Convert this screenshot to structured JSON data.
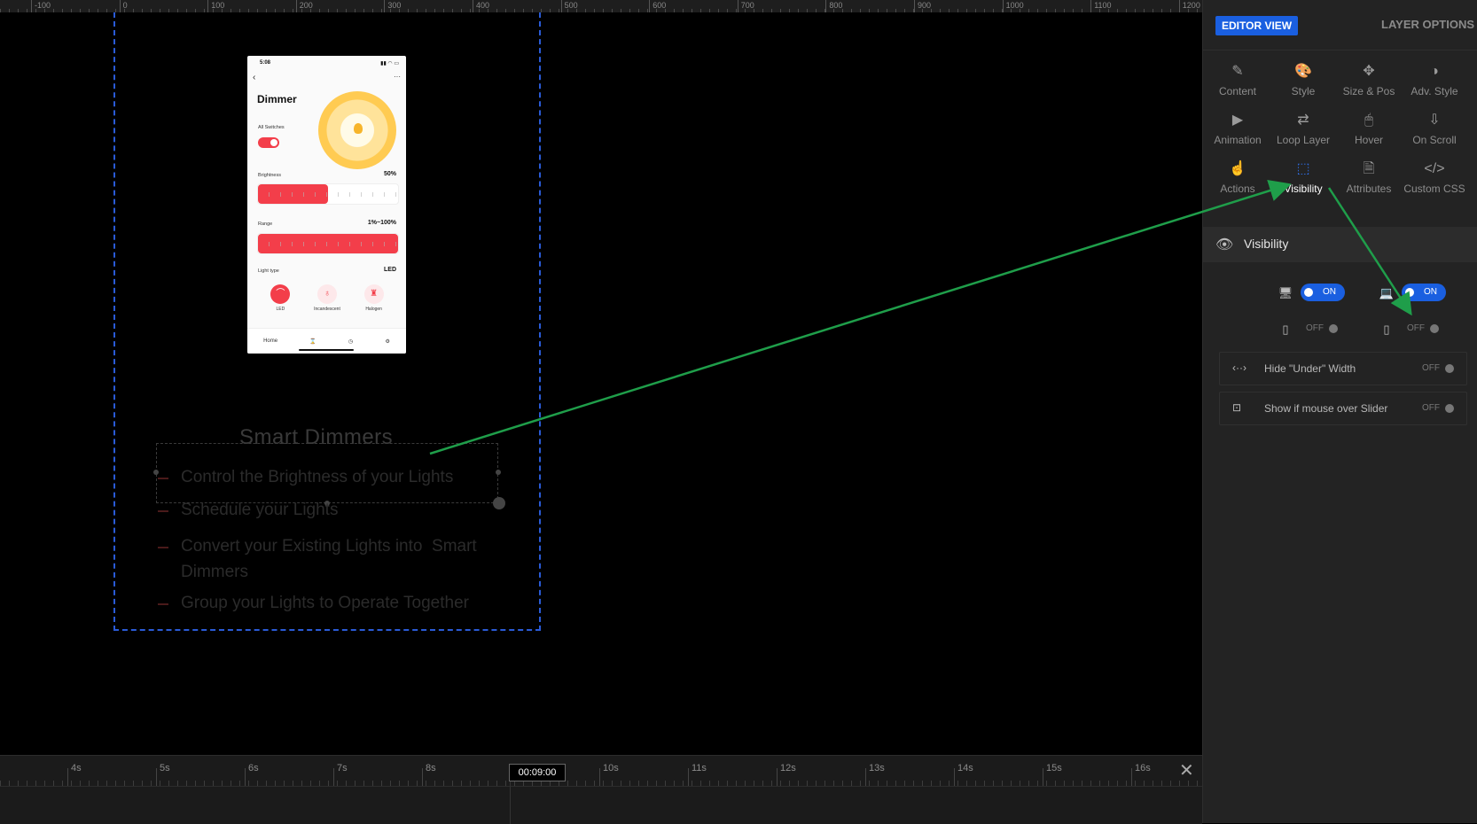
{
  "ruler": {
    "labels": [
      "-100",
      "0",
      "100",
      "200",
      "300",
      "400",
      "500",
      "600",
      "700",
      "800",
      "900",
      "1000",
      "1100",
      "1200"
    ]
  },
  "phone": {
    "time": "5:08",
    "status_icons": "▮▮ ◠ ▭",
    "title": "Dimmer",
    "all_switches_label": "All Switches",
    "brightness_label": "Brightness",
    "brightness_value": "50%",
    "brightness_fraction": 0.5,
    "range_label": "Range",
    "range_value": "1%~100%",
    "light_type_label": "Light type",
    "light_type_value": "LED",
    "types": [
      {
        "label": "LED",
        "icon": "ceiling-light-icon"
      },
      {
        "label": "Incandescent",
        "icon": "bulb-icon"
      },
      {
        "label": "Halogen",
        "icon": "halogen-icon"
      }
    ],
    "tabs": [
      "Home",
      "⌛",
      "◷",
      "⚙"
    ]
  },
  "slide": {
    "title": "Smart Dimmers",
    "bullets": [
      "Control the Brightness of your Lights",
      "Schedule your Lights",
      "Convert your Existing Lights into  Smart Dimmers",
      "Group your Lights to Operate Together"
    ]
  },
  "timeline": {
    "labels": [
      "4s",
      "5s",
      "6s",
      "7s",
      "8s",
      "10s",
      "11s",
      "12s",
      "13s",
      "14s",
      "15s",
      "16s"
    ],
    "current_time": "00:09:00",
    "close": "✕"
  },
  "panel": {
    "editor_view": "EDITOR VIEW",
    "layer_options": "LAYER OPTIONS",
    "tools": [
      {
        "label": "Content",
        "icon": "✎",
        "name": "pencil-icon"
      },
      {
        "label": "Style",
        "icon": "🎨",
        "name": "palette-icon"
      },
      {
        "label": "Size & Pos",
        "icon": "✥",
        "name": "move-icon"
      },
      {
        "label": "Adv. Style",
        "icon": "◑",
        "name": "contrast-icon"
      },
      {
        "label": "Animation",
        "icon": "▶",
        "name": "play-icon"
      },
      {
        "label": "Loop Layer",
        "icon": "⇄",
        "name": "loop-icon"
      },
      {
        "label": "Hover",
        "icon": "🖱",
        "name": "mouse-icon"
      },
      {
        "label": "On Scroll",
        "icon": "⇩",
        "name": "scroll-download-icon"
      },
      {
        "label": "Actions",
        "icon": "☝",
        "name": "hand-pointer-icon"
      },
      {
        "label": "Visibility",
        "icon": "⬚",
        "name": "visibility-screen-icon"
      },
      {
        "label": "Attributes",
        "icon": "🗎",
        "name": "document-icon"
      },
      {
        "label": "Custom CSS",
        "icon": "</>",
        "name": "code-icon"
      }
    ],
    "active_tool": "Visibility",
    "section_title": "Visibility",
    "devices": {
      "desktop": "ON",
      "laptop": "ON",
      "tablet": "OFF",
      "mobile": "OFF"
    },
    "options": [
      {
        "label": "Hide \"Under\" Width",
        "state": "OFF",
        "icon": "‹··›"
      },
      {
        "label": "Show if mouse over Slider",
        "state": "OFF",
        "icon": "⊡"
      }
    ]
  },
  "colors": {
    "accent": "#1a5fe0",
    "arrow": "#1f9e4a",
    "brand_red": "#f33e4a"
  }
}
